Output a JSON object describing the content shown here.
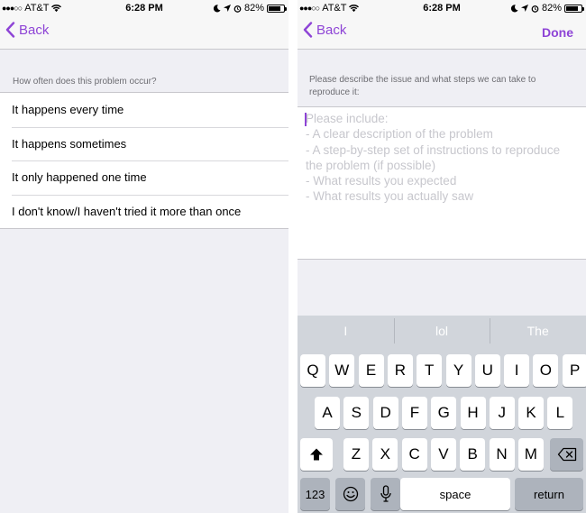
{
  "status_bar": {
    "signal": "●●●○○",
    "carrier": "AT&T",
    "time": "6:28 PM",
    "battery": "82%",
    "battery_level": 0.82
  },
  "left_screen": {
    "back_label": "Back",
    "question": "How often does this problem occur?",
    "options": [
      "It happens every time",
      "It happens sometimes",
      "It only happened one time",
      "I don't know/I haven't tried it more than once"
    ]
  },
  "right_screen": {
    "back_label": "Back",
    "done_label": "Done",
    "prompt": "Please describe the issue and what steps we can take to reproduce it:",
    "placeholder": "Please include:\n- A clear description of the problem\n- A step-by-step set of instructions to reproduce the problem (if possible)\n- What results you expected\n- What results you actually saw"
  },
  "keyboard": {
    "suggestions": [
      "I",
      "lol",
      "The"
    ],
    "row1": [
      "Q",
      "W",
      "E",
      "R",
      "T",
      "Y",
      "U",
      "I",
      "O",
      "P"
    ],
    "row2": [
      "A",
      "S",
      "D",
      "F",
      "G",
      "H",
      "J",
      "K",
      "L"
    ],
    "row3": [
      "Z",
      "X",
      "C",
      "V",
      "B",
      "N",
      "M"
    ],
    "numbers_label": "123",
    "space_label": "space",
    "return_label": "return"
  },
  "colors": {
    "accent": "#8e44d6",
    "background": "#efeff4",
    "keyboard_bg": "#d1d5db"
  }
}
